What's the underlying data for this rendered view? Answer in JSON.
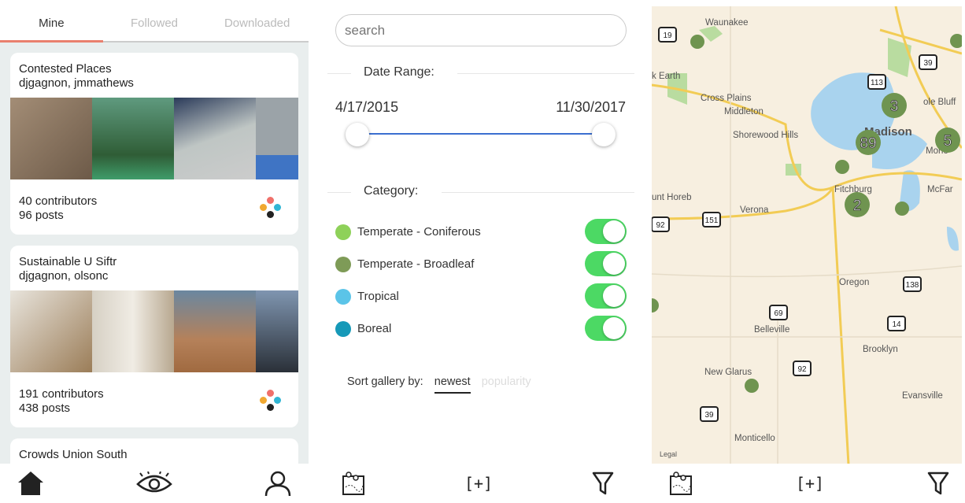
{
  "gallery": {
    "tabs": [
      {
        "label": "Mine",
        "active": true
      },
      {
        "label": "Followed"
      },
      {
        "label": "Downloaded"
      }
    ],
    "accent": "#e9806e",
    "cards": [
      {
        "title": "Contested Places",
        "owners": "djgagnon, jmmathews",
        "contributors": "40 contributors",
        "posts": "96 posts",
        "photo_colors": [
          "#8a7560",
          "#3f7a52",
          "#8c9aa3",
          "#3f74c4"
        ]
      },
      {
        "title": "Sustainable U Siftr",
        "owners": "djgagnon, olsonc",
        "contributors": "191 contributors",
        "posts": "438 posts",
        "photo_colors": [
          "#b8a48a",
          "#d8d2c6",
          "#9a6d46",
          "#3e4c5a"
        ]
      },
      {
        "title": "Crowds Union South"
      }
    ],
    "nav_icons": [
      "home-icon",
      "eye-icon",
      "user-icon"
    ]
  },
  "filter": {
    "search_placeholder": "search",
    "date_range_label": "Date Range:",
    "start_date": "4/17/2015",
    "end_date": "11/30/2017",
    "category_label": "Category:",
    "categories": [
      {
        "label": "Temperate - Coniferous",
        "color": "#8ed159",
        "enabled": true
      },
      {
        "label": "Temperate - Broadleaf",
        "color": "#7e9b57",
        "enabled": true
      },
      {
        "label": "Tropical",
        "color": "#5bc4e8",
        "enabled": true
      },
      {
        "label": "Boreal",
        "color": "#1699b8",
        "enabled": true
      }
    ],
    "sort_label": "Sort gallery by:",
    "sort_options": [
      {
        "label": "newest",
        "active": true
      },
      {
        "label": "popularity"
      }
    ],
    "toggle_color": "#4cd964"
  },
  "map": {
    "places": [
      "Waunakee",
      "k Earth",
      "Cross Plains",
      "Middleton",
      "ole Bluff",
      "Madison",
      "Shorewood Hills",
      "Mono",
      "Fitchburg",
      "McFar",
      "unt Horeb",
      "Verona",
      "Oregon",
      "Belleville",
      "Brooklyn",
      "New Glarus",
      "Evansville",
      "Monticello"
    ],
    "routes": [
      "19",
      "113",
      "39",
      "151",
      "92",
      "138",
      "69",
      "14",
      "92",
      "39"
    ],
    "clusters": [
      "3",
      "89",
      "5",
      "2"
    ],
    "legal": "Legal",
    "marker_color": "#6f9450"
  },
  "toolbar_icons": [
    "map-pins-icon",
    "add-bracket-icon",
    "filter-icon"
  ],
  "toolbar_add": "[+]"
}
